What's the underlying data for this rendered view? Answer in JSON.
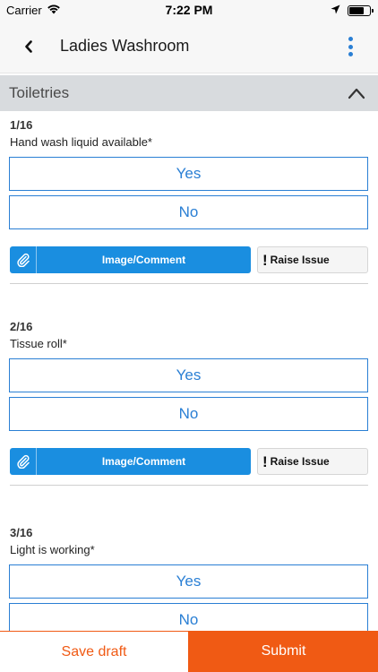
{
  "status_bar": {
    "carrier": "Carrier",
    "time": "7:22 PM",
    "battery_level": 0.8
  },
  "nav": {
    "title": "Ladies Washroom"
  },
  "section": {
    "title": "Toiletries"
  },
  "questions": [
    {
      "number": "1/16",
      "text": "Hand wash liquid available*",
      "yes_label": "Yes",
      "no_label": "No",
      "image_comment_label": "Image/Comment",
      "raise_issue_label": "Raise Issue"
    },
    {
      "number": "2/16",
      "text": "Tissue roll*",
      "yes_label": "Yes",
      "no_label": "No",
      "image_comment_label": "Image/Comment",
      "raise_issue_label": "Raise Issue"
    },
    {
      "number": "3/16",
      "text": "Light is working*",
      "yes_label": "Yes",
      "no_label": "No"
    }
  ],
  "footer": {
    "save_draft_label": "Save draft",
    "submit_label": "Submit"
  },
  "colors": {
    "accent_blue": "#2a7fd4",
    "button_blue": "#1a8ee0",
    "accent_orange": "#f05a14",
    "section_bg": "#d8dbde"
  }
}
